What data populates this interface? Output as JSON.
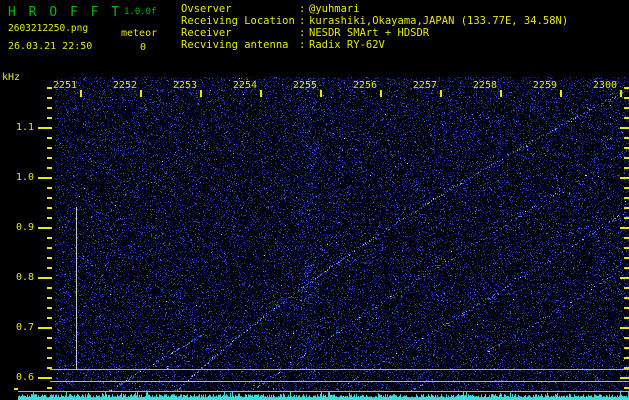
{
  "header": {
    "title": "H R O F F T",
    "version": "1.0.0f",
    "filename": "2603212250.png",
    "counter_label": "meteor",
    "counter_value": "0",
    "datetime": "26.03.21 22:50",
    "title_color": "#00bb00",
    "text_color": "#e8e800"
  },
  "info_panel": {
    "separator": ":",
    "rows": [
      {
        "label": "Ovserver",
        "value": "@yuhmari"
      },
      {
        "label": "Receiving Location",
        "value": "kurashiki,Okayama,JAPAN (133.77E, 34.58N)"
      },
      {
        "label": "Receiver",
        "value": "NESDR SMArt + HDSDR"
      },
      {
        "label": "Recviving antenna",
        "value": "Radix RY-62V"
      }
    ]
  },
  "chart_data": {
    "type": "heatmap",
    "subtype": "radio-meteor-spectrogram",
    "x_axis": {
      "unit": "time (HHMM)",
      "tick_labels": [
        "2251",
        "2252",
        "2253",
        "2254",
        "2255",
        "2256",
        "2257",
        "2258",
        "2259",
        "2300"
      ],
      "start_minute": 1,
      "minutes_span": 10
    },
    "y_axis": {
      "label": "kHz",
      "tick_labels": [
        "1.1",
        "1.0",
        "0.9",
        "0.8",
        "0.7",
        "0.6"
      ],
      "major_ticks_khz": [
        1.1,
        1.0,
        0.9,
        0.8,
        0.7,
        0.6
      ],
      "minor_min_khz": 0.58,
      "minor_max_khz": 1.18,
      "minor_step_khz": 0.02
    },
    "reference_lines": [
      {
        "f_khz": 0.618,
        "full_width": false
      },
      {
        "f_khz": 0.594,
        "full_width": false
      },
      {
        "f_khz": 0.574,
        "full_width": true
      }
    ],
    "marker_line": {
      "t_min": 0.6,
      "f_top_khz": 0.942,
      "f_bottom_khz": 0.618
    },
    "event_column": {
      "t_min": 4.8,
      "width_min": 0.25
    },
    "doppler_traces": [
      {
        "name": "aircraft-doppler-1",
        "intensity": 1.0,
        "bezier_t_f": [
          [
            2.45,
            0.556
          ],
          [
            5.2,
            0.87
          ],
          [
            10.2,
            1.18
          ]
        ]
      },
      {
        "name": "aircraft-doppler-2",
        "intensity": 0.8,
        "bezier_t_f": [
          [
            3.65,
            0.556
          ],
          [
            6.3,
            0.78
          ],
          [
            10.2,
            1.06
          ]
        ]
      },
      {
        "name": "aircraft-doppler-3",
        "intensity": 0.7,
        "bezier_t_f": [
          [
            5.0,
            0.556
          ],
          [
            7.6,
            0.74
          ],
          [
            10.2,
            0.94
          ]
        ]
      },
      {
        "name": "aircraft-doppler-4",
        "intensity": 0.45,
        "bezier_t_f": [
          [
            1.25,
            0.556
          ],
          [
            2.1,
            0.62
          ],
          [
            3.1,
            0.69
          ]
        ]
      },
      {
        "name": "aircraft-doppler-5",
        "intensity": 0.4,
        "bezier_t_f": [
          [
            6.2,
            0.556
          ],
          [
            8.2,
            0.67
          ],
          [
            10.2,
            0.83
          ]
        ]
      }
    ],
    "noise": {
      "seed": 987654321,
      "density": 0.45
    },
    "colors": {
      "axis": "#e8e800",
      "grid_line": "#b0b0b0",
      "waveform": "#3cdcdc",
      "noise_palette": [
        "#000022",
        "#000f3d",
        "#16246e",
        "#23399b",
        "#3350cc",
        "#4f74e8"
      ],
      "trace_palette": [
        "#2a50d8",
        "#4878f0",
        "#7fb0ff",
        "#b8e4ff"
      ],
      "bright_speck": "#b8dcff"
    }
  }
}
